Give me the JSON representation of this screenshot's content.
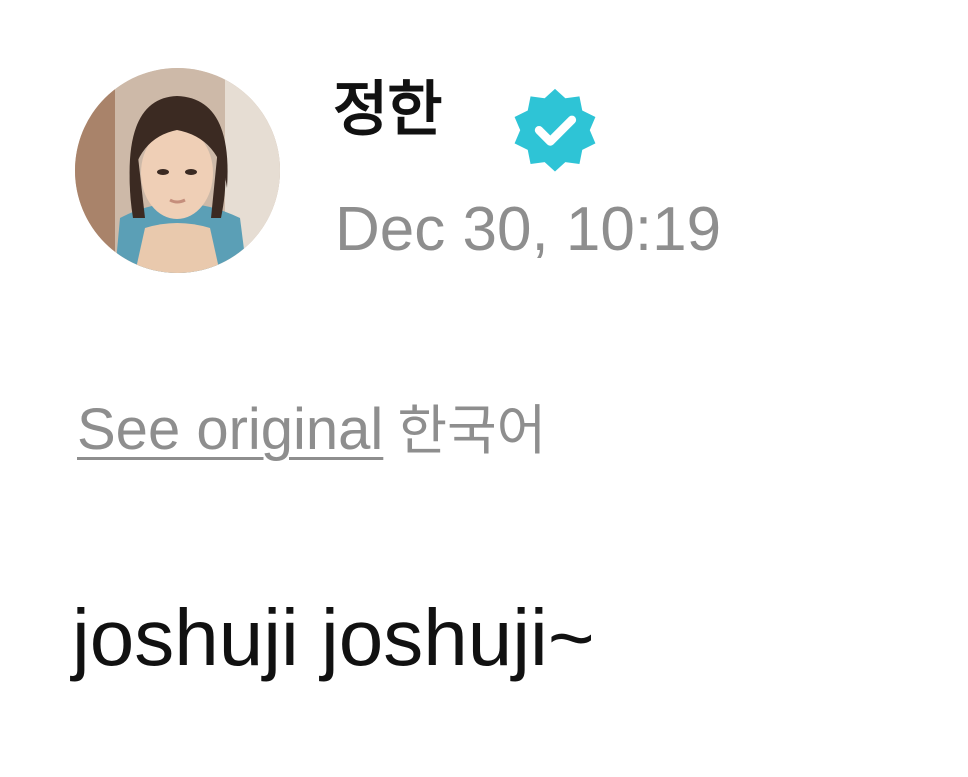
{
  "post": {
    "author": {
      "name": "정한",
      "verified": true,
      "avatar": "profile-photo"
    },
    "timestamp": "Dec 30, 10:19",
    "translation": {
      "see_original_label": "See original",
      "source_language": "한국어"
    },
    "body_text": "joshuji joshuji~"
  },
  "colors": {
    "badge": "#2ec4d6",
    "muted_text": "#8e8e8e",
    "primary_text": "#111111",
    "background": "#ffffff"
  },
  "icons": {
    "verified": "verified-badge-icon"
  }
}
